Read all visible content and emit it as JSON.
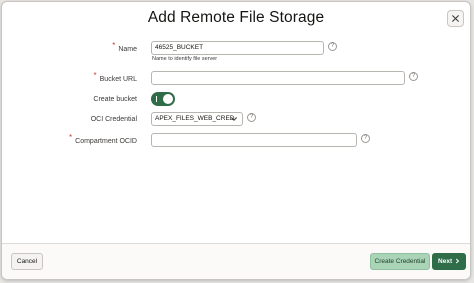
{
  "dialog": {
    "title": "Add Remote File Storage",
    "close_icon": "close-icon"
  },
  "form": {
    "name": {
      "label": "Name",
      "required": true,
      "value": "46525_BUCKET",
      "hint": "Name to identify file server"
    },
    "bucket_url": {
      "label": "Bucket URL",
      "required": true,
      "value": ""
    },
    "create_bucket": {
      "label": "Create bucket",
      "checked": true
    },
    "oci_credential": {
      "label": "OCI Credential",
      "value": "APEX_FILES_WEB_CRED"
    },
    "compartment_ocid": {
      "label": "Compartment OCID",
      "required": true,
      "value": ""
    },
    "required_marker": "*",
    "help_icon_text": "?"
  },
  "footer": {
    "cancel_label": "Cancel",
    "create_credential_label": "Create Credential",
    "next_label": "Next",
    "next_icon": "chevron-right-icon"
  },
  "colors": {
    "accent": "#2f6d49",
    "required": "#c74634",
    "secondary_button": "#a9d4b5"
  }
}
